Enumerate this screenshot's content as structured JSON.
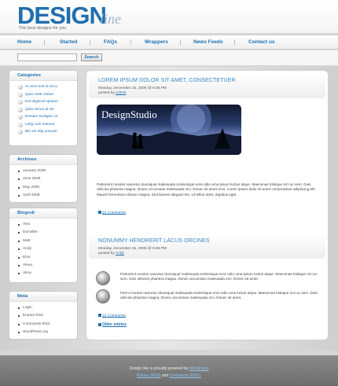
{
  "site": {
    "logo_main": "DESIGN",
    "logo_sub": "line",
    "tagline": "The best designs for you"
  },
  "nav": {
    "items": [
      {
        "label": "Home"
      },
      {
        "label": "Started"
      },
      {
        "label": "FAQs"
      },
      {
        "label": "Wrappers"
      },
      {
        "label": "News Feeds"
      },
      {
        "label": "Contact us"
      }
    ]
  },
  "search": {
    "value": "",
    "button_label": "Search"
  },
  "sidebar": {
    "categories": {
      "title": "Categories",
      "items": [
        "At vero eos et accu",
        "Quis nostr exitue",
        "Est eligendi optione",
        "Quis minus at vie",
        "Etusam turdigne vir",
        "Lelig cum soluma",
        "Bis vet ellg umoutri"
      ]
    },
    "archives": {
      "title": "Archives",
      "items": [
        "January 2008",
        "June 2008",
        "May 2008",
        "April 2008"
      ]
    },
    "blogroll": {
      "title": "Blogroll",
      "items": [
        "Alex",
        "Dorrathe",
        "Matt",
        "Andy",
        "Elza",
        "Alexa",
        "Alina"
      ]
    },
    "meta": {
      "title": "Meta",
      "items": [
        "Login",
        "Entries RSS",
        "Comments RSS",
        "WordPress.org"
      ]
    }
  },
  "posts": [
    {
      "title": "LOREM IPSUM DOLOR SIT AMET, CONSECTETUER",
      "date": "Monday, December 25, 2006 @ 6:05 PM",
      "posted_by_label": "posted by",
      "author": "Admin",
      "banner_text": "DesignStudio",
      "body": "Parturient montes nascetur duoniqual malesuada scelerisque eros odio urna ipsum luctus atque. Maecenas tristique orci ac sem. Duis ultricies pharetra magna. Donec accumsan malesuada orci. Donec sit amet eros. Lorem ipsum dolor sit amet consectetuer adipiscing elit. Mauris fermentum dictum magna. Sed laoreet aliquam leo. Ut tellus dolor, dapibus eget.",
      "comments": "10 Comments"
    },
    {
      "title": "NONUMMY HENDRERIT LACUS ORCINES",
      "date": "Monday, December 25, 2006 @ 6:05 PM",
      "posted_by_label": "posted by",
      "author": "Andy",
      "items": [
        "Parturient montes nascetur duoniqual malesuada scelerisque eros odio urna ipsum luctus atque. Maecenas tristique orci ac sem. Duis ultricies pharetra magna. Donec accumsan malesuada orci. Donec sit amet.",
        "Fermi montes nascetur duoniqual malesuada scelerisque eros odio urna luctus atque. Maecenas tristique orci ac sem. Duis ultricies pharetra magna. Donec accumsan malesuada orci. Donec sit amet."
      ],
      "comments": "10 Comments"
    }
  ],
  "older_entries": "Older entries",
  "footer": {
    "line1_text": "Design line is proudly powered by",
    "line1_link": "WordPress",
    "line2_link1": "Entries (RSS)",
    "line2_and": "and",
    "line2_link2": "Comments (RSS)."
  }
}
